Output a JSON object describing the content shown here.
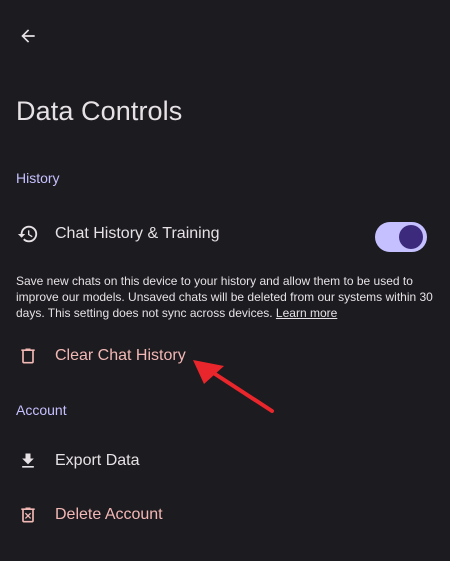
{
  "header": {
    "back_icon": "arrow-left-icon",
    "title": "Data Controls"
  },
  "history": {
    "section_title": "History",
    "chat_history": {
      "icon": "history-icon",
      "label": "Chat History & Training",
      "toggle_on": true
    },
    "description_text": "Save new chats on this device to your history and allow them to be used to improve our models. Unsaved chats will be deleted from our systems within 30 days. This setting does not sync across devices.",
    "learn_more_label": "Learn more",
    "clear": {
      "icon": "trash-icon",
      "label": "Clear Chat History"
    }
  },
  "account": {
    "section_title": "Account",
    "export": {
      "icon": "download-icon",
      "label": "Export Data"
    },
    "delete": {
      "icon": "delete-account-icon",
      "label": "Delete Account"
    }
  },
  "annotation": {
    "arrow_icon": "red-pointer-arrow",
    "color": "#e8262b"
  },
  "colors": {
    "background": "#1c1b1f",
    "accent": "#c5c0ff",
    "toggle_thumb": "#3c2a7d",
    "danger_text": "#f2b8b5",
    "text": "#e6e1e5"
  }
}
